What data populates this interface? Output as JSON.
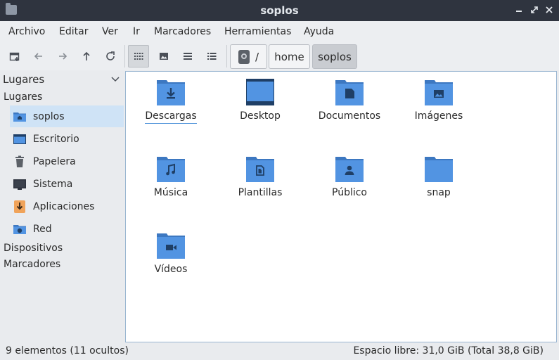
{
  "window": {
    "title": "soplos"
  },
  "menu": [
    "Archivo",
    "Editar",
    "Ver",
    "Ir",
    "Marcadores",
    "Herramientas",
    "Ayuda"
  ],
  "path": {
    "root": "/",
    "crumbs": [
      "home",
      "soplos"
    ]
  },
  "sidebar": {
    "header": "Lugares",
    "section_places": "Lugares",
    "items": [
      {
        "label": "soplos",
        "icon": "home-folder-icon",
        "selected": true
      },
      {
        "label": "Escritorio",
        "icon": "desktop-icon"
      },
      {
        "label": "Papelera",
        "icon": "trash-icon"
      },
      {
        "label": "Sistema",
        "icon": "monitor-icon"
      },
      {
        "label": "Aplicaciones",
        "icon": "applications-icon"
      },
      {
        "label": "Red",
        "icon": "network-folder-icon"
      }
    ],
    "section_devices": "Dispositivos",
    "section_bookmarks": "Marcadores"
  },
  "files": [
    {
      "name": "Descargas",
      "icon": "downloads-folder-icon"
    },
    {
      "name": "Desktop",
      "icon": "desktop-folder-icon"
    },
    {
      "name": "Documentos",
      "icon": "documents-folder-icon"
    },
    {
      "name": "Imágenes",
      "icon": "pictures-folder-icon"
    },
    {
      "name": "Música",
      "icon": "music-folder-icon"
    },
    {
      "name": "Plantillas",
      "icon": "templates-folder-icon"
    },
    {
      "name": "Público",
      "icon": "public-folder-icon"
    },
    {
      "name": "snap",
      "icon": "folder-icon"
    },
    {
      "name": "Vídeos",
      "icon": "videos-folder-icon"
    }
  ],
  "status": {
    "items": "9 elementos (11 ocultos)",
    "free_space": "Espacio libre: 31,0 GiB (Total 38,8 GiB)"
  },
  "colors": {
    "folder": "#5294e2",
    "folder_dark": "#3d78c1",
    "titlebar": "#2f343f",
    "selection": "#cfe3f6"
  }
}
